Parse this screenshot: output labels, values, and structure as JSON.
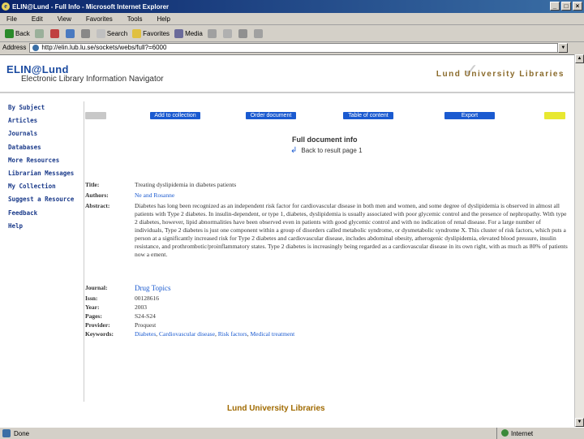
{
  "window": {
    "title": "ELIN@Lund - Full Info - Microsoft Internet Explorer"
  },
  "menu": [
    "File",
    "Edit",
    "View",
    "Favorites",
    "Tools",
    "Help"
  ],
  "toolbar": {
    "back": "Back",
    "search": "Search",
    "favorites": "Favorites",
    "media": "Media"
  },
  "address": {
    "label": "Address",
    "url": "http://elin.lub.lu.se/sockets/webs/full?=6000"
  },
  "header": {
    "logo": "ELIN@Lund",
    "subtitle": "Electronic Library Information Navigator",
    "brand": "Lund University Libraries"
  },
  "nav": [
    "By Subject",
    "Articles",
    "Journals",
    "Databases",
    "More Resources",
    "Librarian Messages",
    "My Collection",
    "Suggest a Resource",
    "Feedback",
    "Help"
  ],
  "actions": {
    "add": "Add to collection",
    "order": "Order document",
    "toc": "Table of content",
    "export": "Export"
  },
  "page": {
    "title": "Full document info",
    "back": "Back to result page 1"
  },
  "record": {
    "labels": {
      "title": "Title:",
      "authors": "Authors:",
      "abstract": "Abstract:",
      "journal": "Journal:",
      "issn": "Issn:",
      "year": "Year:",
      "pages": "Pages:",
      "provider": "Provider:",
      "keywords": "Keywords:"
    },
    "title": "Treating dyslipidemia in diabetes patients",
    "authors": "Ne and Rosanne",
    "abstract": "Diabetes has long been recognized as an independent risk factor for cardiovascular disease in both men and women, and some degree of dyslipidemia is observed in almost all patients with Type 2 diabetes. In insulin-dependent, or type 1, diabetes, dyslipidemia is usually associated with poor glycemic control and the presence of nephropathy. With type 2 diabetes, however, lipid abnormalities have been observed even in patients with good glycemic control and with no indication of renal disease. For a large number of individuals, Type 2 diabetes is just one component within a group of disorders called metabolic syndrome, or dysmetabolic syndrome X. This cluster of risk factors, which puts a person at a significantly increased risk for Type 2 diabetes and cardiovascular disease, includes abdominal obesity, atherogenic dyslipidemia, elevated blood pressure, insulin resistance, and prothrombotic/proinflammatory states. Type 2 diabetes is increasingly being regarded as a cardiovascular disease in its own right, with as much as 80% of patients now a  ement.",
    "journal": "Drug Topics",
    "issn": "00128616",
    "year": "2003",
    "pages": "S24-S24",
    "provider": "Proquest",
    "keywords": [
      "Diabetes",
      "Cardiovascular disease",
      "Risk factors",
      "Medical treatment"
    ]
  },
  "footer": "Lund University Libraries",
  "status": {
    "left": "Done",
    "zone": "Internet"
  }
}
